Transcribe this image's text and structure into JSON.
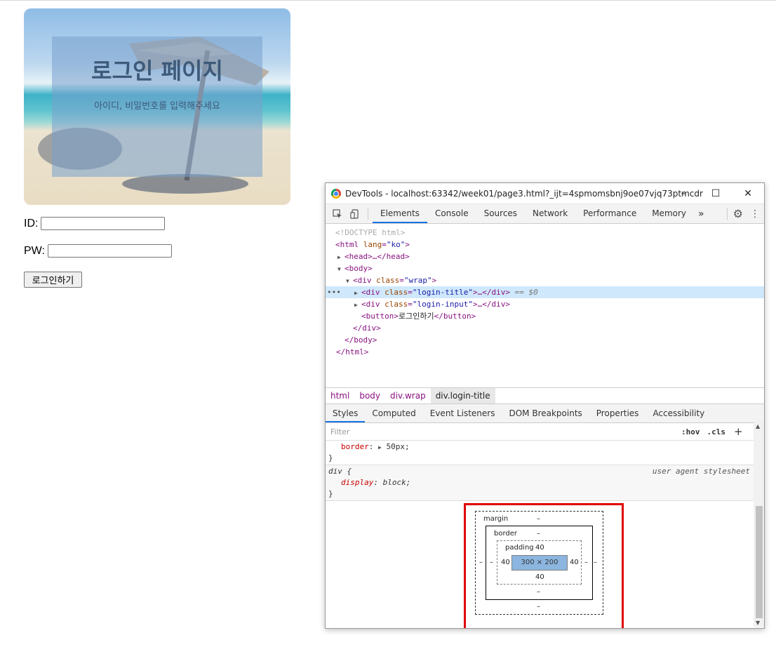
{
  "page": {
    "title": "로그인 페이지",
    "subtitle": "아이디, 비밀번호를 입력해주세요",
    "id_label": "ID:",
    "pw_label": "PW:",
    "id_value": "",
    "pw_value": "",
    "login_button": "로그인하기"
  },
  "devtools": {
    "window_title": "DevTools - localhost:63342/week01/page3.html?_ijt=4spmomsbnj9oe07vjq73ptmcdr",
    "window_buttons": [
      "–",
      "☐",
      "✕"
    ],
    "tabs": [
      "Elements",
      "Console",
      "Sources",
      "Network",
      "Performance",
      "Memory"
    ],
    "more_tabs": "»",
    "active_tab": "Elements",
    "dom": {
      "doctype": "<!DOCTYPE html>",
      "html_open_tag": "<html",
      "html_lang_attr": "lang",
      "html_lang_val": "\"ko\"",
      "head": "<head>…</head>",
      "body_open": "<body>",
      "wrap_div": "<div",
      "class_attr": "class",
      "wrap_class": "\"wrap\"",
      "login_title_class": "\"login-title\"",
      "login_input_class": "\"login-input\"",
      "collapsed": ">…</div>",
      "selected_marker": "== $0",
      "button_open": "<button>",
      "button_text": "로그인하기",
      "button_close": "</button>",
      "div_close": "</div>",
      "body_close": "</body>",
      "html_close": "</html>",
      "gt": ">",
      "dots": "•••"
    },
    "breadcrumbs": [
      "html",
      "body",
      "div.wrap",
      "div.login-title"
    ],
    "subtabs": [
      "Styles",
      "Computed",
      "Event Listeners",
      "DOM Breakpoints",
      "Properties",
      "Accessibility"
    ],
    "active_subtab": "Styles",
    "filter_placeholder": "Filter",
    "hov": ":hov",
    "cls": ".cls",
    "plus": "+",
    "styles": {
      "border_prop": "border",
      "border_val": "50px;",
      "close_brace": "}",
      "div_selector": "div {",
      "ua_label": "user agent stylesheet",
      "display_prop": "display",
      "display_val": "block;"
    },
    "box_model": {
      "margin_label": "margin",
      "margin_top": "–",
      "margin_bottom": "–",
      "margin_left": "–",
      "margin_right": "–",
      "border_label": "border",
      "border_top": "–",
      "border_bottom": "–",
      "border_left": "–",
      "border_right": "–",
      "padding_label": "padding",
      "padding_top": "40",
      "padding_bottom": "40",
      "padding_left": "40",
      "padding_right": "40",
      "content": "300 × 200"
    }
  },
  "colors": {
    "highlight_box": "#e00000",
    "selected_line": "#cfe8fc",
    "active_tab_underline": "#1a73e8"
  }
}
